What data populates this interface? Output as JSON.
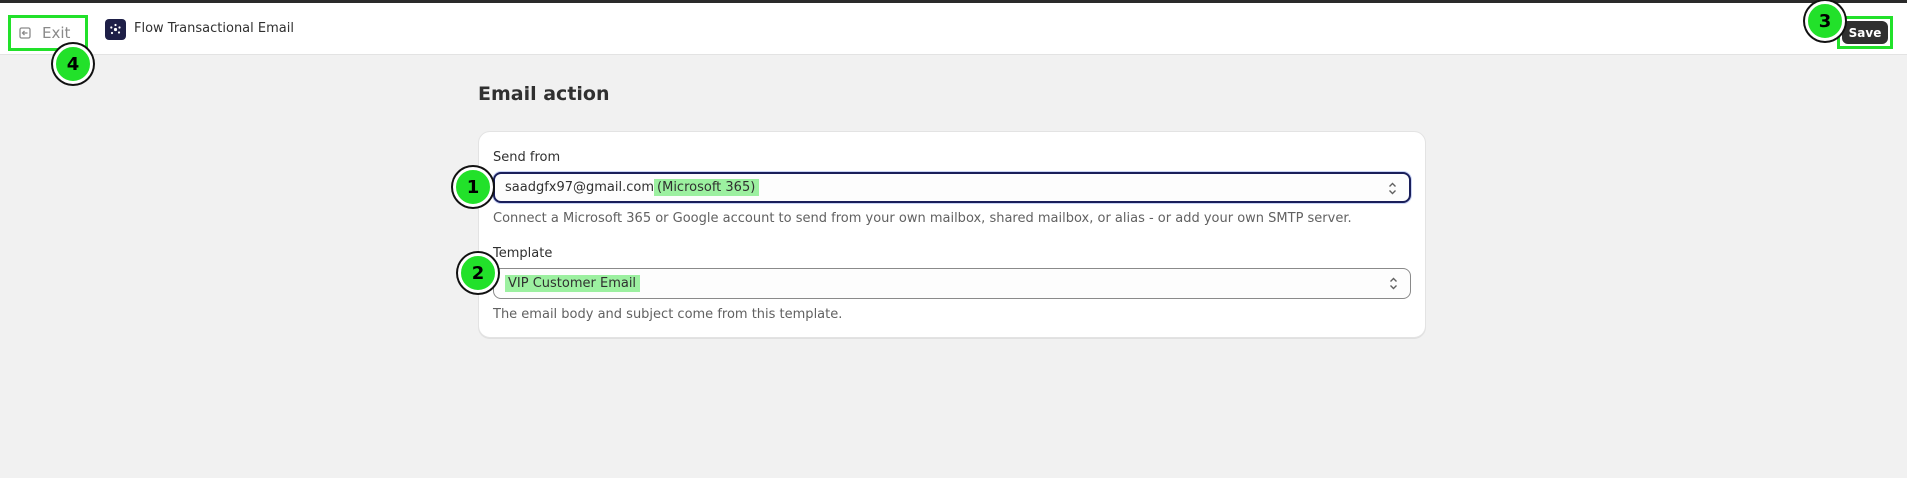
{
  "header": {
    "exit_label": "Exit",
    "app_title": "Flow Transactional Email",
    "save_label": "Save",
    "exit_icon": "exit-icon",
    "app_icon": "flow-app-icon"
  },
  "page": {
    "title": "Email action"
  },
  "form": {
    "send_from": {
      "label": "Send from",
      "value_email": "saadgfx97@gmail.com",
      "value_provider": "(Microsoft 365)",
      "help": "Connect a Microsoft 365 or Google account to send from your own mailbox, shared mailbox, or alias - or add your own SMTP server."
    },
    "template": {
      "label": "Template",
      "value": "VIP Customer Email",
      "help": "The email body and subject come from this template."
    }
  },
  "markers": [
    "1",
    "2",
    "3",
    "4"
  ],
  "colors": {
    "marker_green": "#22e12a",
    "highlight_green": "#9cf0a0",
    "save_button": "#303030",
    "focus_ring": "#1a1f5a"
  }
}
